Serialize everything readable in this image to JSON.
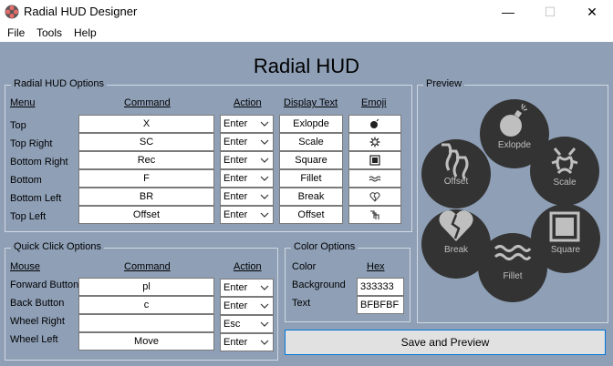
{
  "window": {
    "title": "Radial HUD Designer",
    "minimize": "—",
    "maximize": "☐",
    "close": "✕"
  },
  "menu": [
    "File",
    "Tools",
    "Help"
  ],
  "app_title": "Radial HUD",
  "options": {
    "legend": "Radial HUD Options",
    "headers": {
      "menu": "Menu",
      "command": "Command",
      "action": "Action",
      "display": "Display Text",
      "emoji": "Emoji"
    },
    "rows": [
      {
        "menu": "Top",
        "command": "X",
        "action": "Enter",
        "display": "Exlopde",
        "emoji": "bomb-icon"
      },
      {
        "menu": "Top Right",
        "command": "SC",
        "action": "Enter",
        "display": "Scale",
        "emoji": "collision-icon"
      },
      {
        "menu": "Bottom Right",
        "command": "Rec",
        "action": "Enter",
        "display": "Square",
        "emoji": "square-icon"
      },
      {
        "menu": "Bottom",
        "command": "F",
        "action": "Enter",
        "display": "Fillet",
        "emoji": "wave-icon"
      },
      {
        "menu": "Bottom Left",
        "command": "BR",
        "action": "Enter",
        "display": "Break",
        "emoji": "broken-heart-icon"
      },
      {
        "menu": "Top Left",
        "command": "Offset",
        "action": "Enter",
        "display": "Offset",
        "emoji": "offset-icon"
      }
    ]
  },
  "quick": {
    "legend": "Quick Click Options",
    "headers": {
      "mouse": "Mouse",
      "command": "Command",
      "action": "Action"
    },
    "rows": [
      {
        "mouse": "Forward Button",
        "command": "pl",
        "action": "Enter"
      },
      {
        "mouse": "Back Button",
        "command": "c",
        "action": "Enter"
      },
      {
        "mouse": "Wheel Right",
        "command": "",
        "action": "Esc"
      },
      {
        "mouse": "Wheel Left",
        "command": "Move",
        "action": "Enter"
      }
    ]
  },
  "colors": {
    "legend": "Color Options",
    "headers": {
      "color": "Color",
      "hex": "Hex"
    },
    "rows": [
      {
        "label": "Background",
        "hex": "333333"
      },
      {
        "label": "Text",
        "hex": "BFBFBF"
      }
    ]
  },
  "preview": {
    "legend": "Preview",
    "bg": "#333333",
    "text_color": "#BFBFBF",
    "segments": [
      {
        "label": "Exlopde",
        "icon": "bomb-icon"
      },
      {
        "label": "Scale",
        "icon": "collision-icon"
      },
      {
        "label": "Square",
        "icon": "square-icon"
      },
      {
        "label": "Fillet",
        "icon": "wave-icon"
      },
      {
        "label": "Break",
        "icon": "broken-heart-icon"
      },
      {
        "label": "Offset",
        "icon": "offset-icon"
      }
    ]
  },
  "save_button": "Save and Preview"
}
